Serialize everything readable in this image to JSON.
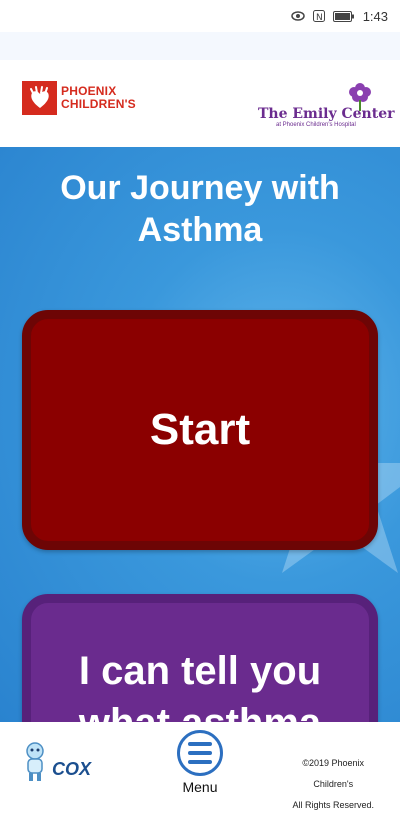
{
  "status_bar": {
    "time": "1:43",
    "icons": [
      "eye-comfort-icon",
      "nfc-icon",
      "battery-icon"
    ]
  },
  "header": {
    "left_logo": {
      "line1": "PHOENIX",
      "line2": "CHILDREN'S",
      "color": "#d52b1e"
    },
    "right_logo": {
      "name": "The Emily Center",
      "subtitle": "at Phoenix Children's Hospital",
      "color": "#6b2c8f"
    }
  },
  "main": {
    "title_line1": "Our Journey with",
    "title_line2": "Asthma",
    "buttons": [
      {
        "label": "Start",
        "color": "#8b0000"
      },
      {
        "label_line1": "I can tell you",
        "label_line2": "what asthma",
        "color": "#6a2b8e"
      }
    ]
  },
  "footer": {
    "sponsor_logo": {
      "text": "COX"
    },
    "menu": {
      "label": "Menu",
      "icon": "hamburger-menu-icon"
    },
    "copyright_line1": "©2019 Phoenix",
    "copyright_line2": "Children's",
    "copyright_line3": "All Rights Reserved."
  }
}
